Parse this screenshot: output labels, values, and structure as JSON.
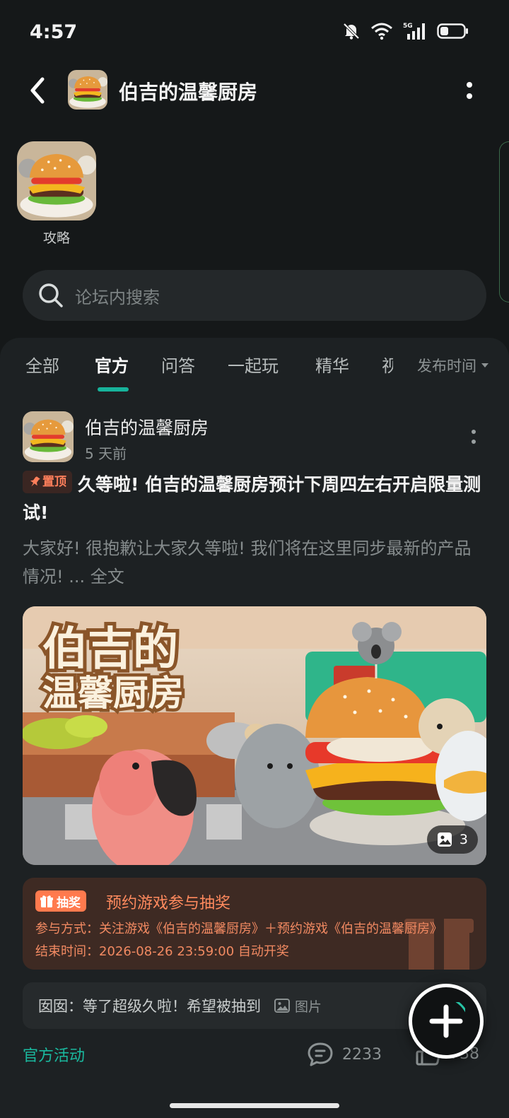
{
  "status_bar": {
    "time": "4:57",
    "network": "5G"
  },
  "header": {
    "title": "伯吉的温馨厨房"
  },
  "app_tile": {
    "label": "攻略"
  },
  "search": {
    "placeholder": "论坛内搜索"
  },
  "tabs": [
    {
      "label": "全部",
      "active": false
    },
    {
      "label": "官方",
      "active": true
    },
    {
      "label": "问答",
      "active": false
    },
    {
      "label": "一起玩",
      "active": false
    },
    {
      "label": "精华",
      "active": false
    },
    {
      "label": "视频",
      "active": false
    }
  ],
  "sort": {
    "label": "发布时间"
  },
  "post": {
    "author": "伯吉的温馨厨房",
    "time": "5 天前",
    "pin_label": "置顶",
    "title": "久等啦! 伯吉的温馨厨房预计下周四左右开启限量测试!",
    "excerpt": "大家好! 很抱歉让大家久等啦! 我们将在这里同步最新的产品情况!",
    "excerpt_more": "... 全文",
    "image_count": "3",
    "image_title_line1": "伯吉的",
    "image_title_line2": "温馨厨房",
    "lottery": {
      "badge": "抽奖",
      "title": "预约游戏参与抽奖",
      "method": "参与方式：关注游戏《伯吉的温馨厨房》＋预约游戏《伯吉的温馨厨房》",
      "end_time": "结束时间：2026-08-26 23:59:00 自动开奖"
    },
    "comment": {
      "user": "囡囡",
      "text": "：等了超级久啦！希望被抽到",
      "image_tag": "图片"
    },
    "footer": {
      "tag": "官方活动",
      "comments": "2233",
      "likes": "738"
    }
  },
  "colors": {
    "accent": "#17b39b",
    "lottery_orange": "#ff7a4e",
    "background": "#151819",
    "sheet": "#1d2123"
  }
}
